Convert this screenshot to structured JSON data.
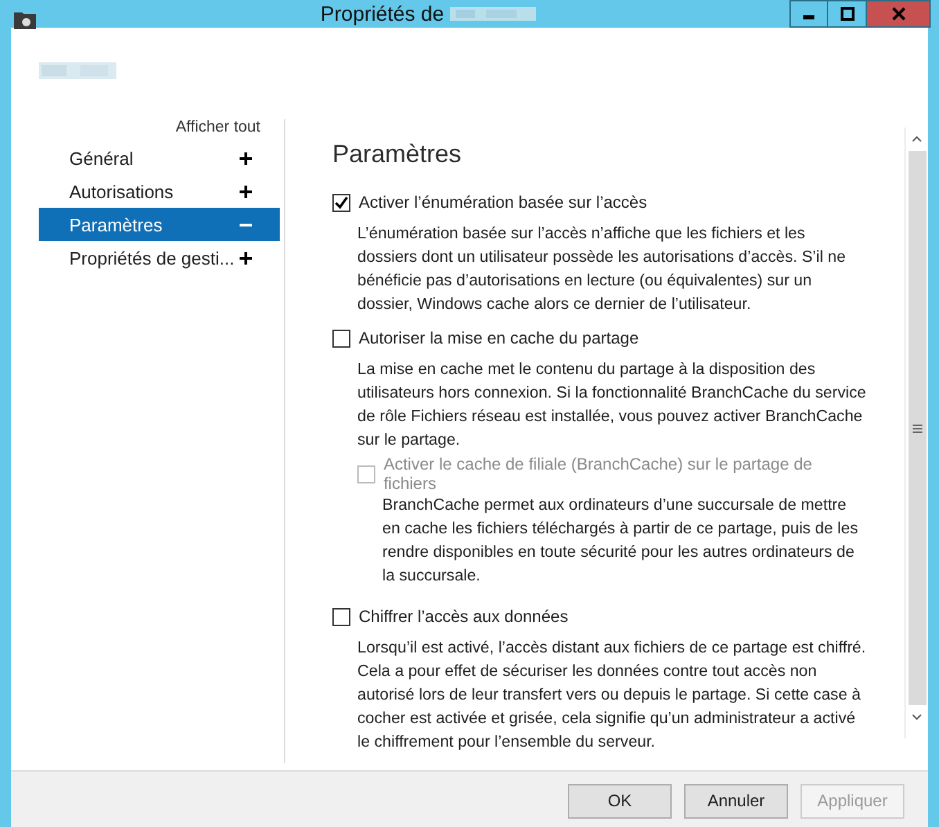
{
  "window": {
    "title": "Propriétés de"
  },
  "sidebar": {
    "show_all": "Afficher tout",
    "items": [
      {
        "label": "Général",
        "selected": false,
        "expanded": false
      },
      {
        "label": "Autorisations",
        "selected": false,
        "expanded": false
      },
      {
        "label": "Paramètres",
        "selected": true,
        "expanded": true
      },
      {
        "label": "Propriétés de gesti...",
        "selected": false,
        "expanded": false
      }
    ]
  },
  "section": {
    "title": "Paramètres",
    "options": [
      {
        "label": "Activer l’énumération basée sur l’accès",
        "checked": true,
        "disabled": false,
        "description": "L’énumération basée sur l’accès n’affiche que les fichiers et les dossiers dont un utilisateur possède les autorisations d’accès. S’il ne bénéficie pas d’autorisations en lecture (ou équivalentes) sur un dossier, Windows cache alors ce dernier de l’utilisateur."
      },
      {
        "label": "Autoriser la mise en cache du partage",
        "checked": false,
        "disabled": false,
        "description": "La mise en cache met le contenu du partage à la disposition des utilisateurs hors connexion. Si la fonctionnalité BranchCache du service de rôle Fichiers réseau est installée, vous pouvez activer BranchCache sur le partage.",
        "children": [
          {
            "label": "Activer le cache de filiale (BranchCache) sur le partage de fichiers",
            "checked": false,
            "disabled": true,
            "description": "BranchCache permet aux ordinateurs d’une succursale de mettre en cache les fichiers téléchargés à partir de ce partage, puis de les rendre disponibles en toute sécurité pour les autres ordinateurs de la succursale."
          }
        ]
      },
      {
        "label": "Chiffrer l’accès aux données",
        "checked": false,
        "disabled": false,
        "description": "Lorsqu’il est activé, l’accès distant aux fichiers de ce partage est chiffré. Cela a pour effet de sécuriser les données contre tout accès non autorisé lors de leur transfert vers ou depuis le partage. Si cette case à cocher est activée et grisée, cela signifie qu’un administrateur a activé le chiffrement pour l’ensemble du serveur."
      }
    ]
  },
  "buttons": [
    {
      "label": "OK",
      "disabled": false
    },
    {
      "label": "Annuler",
      "disabled": false
    },
    {
      "label": "Appliquer",
      "disabled": true
    }
  ]
}
